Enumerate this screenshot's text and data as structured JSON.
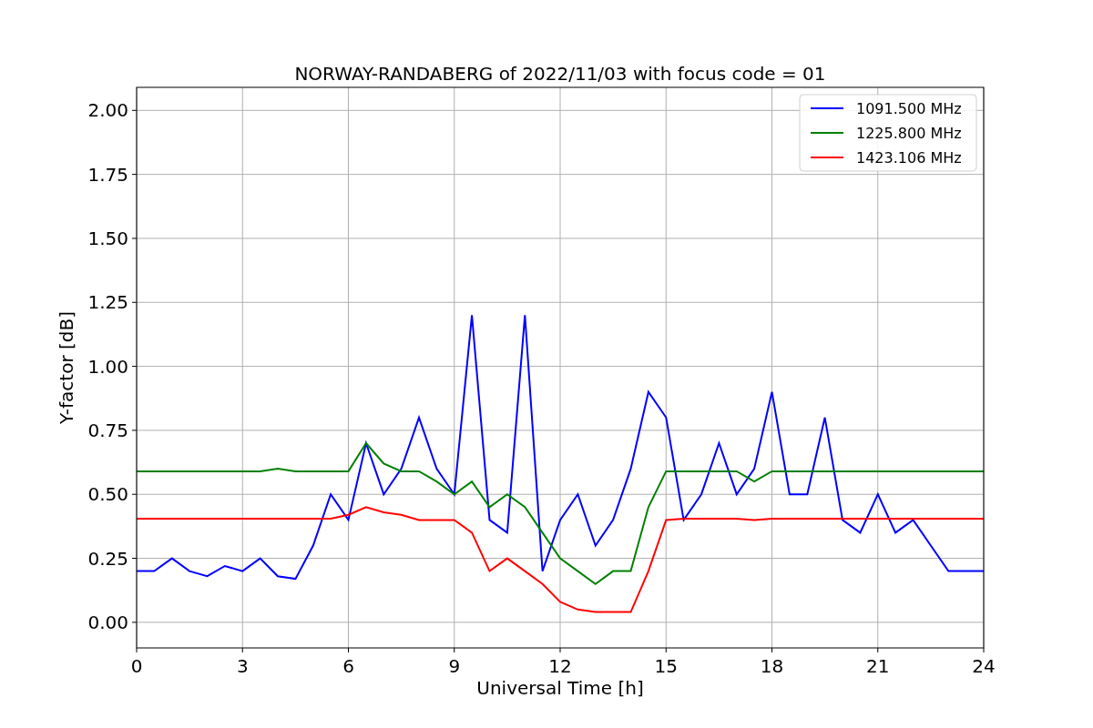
{
  "chart_data": {
    "type": "line",
    "title": "NORWAY-RANDABERG of 2022/11/03 with focus code = 01",
    "xlabel": "Universal Time [h]",
    "ylabel": "Y-factor [dB]",
    "x": [
      0,
      0.5,
      1,
      1.5,
      2,
      2.5,
      3,
      3.5,
      4,
      4.5,
      5,
      5.5,
      6,
      6.5,
      7,
      7.5,
      8,
      8.5,
      9,
      9.5,
      10,
      10.5,
      11,
      11.5,
      12,
      12.5,
      13,
      13.5,
      14,
      14.5,
      15,
      15.5,
      16,
      16.5,
      17,
      17.5,
      18,
      18.5,
      19,
      19.5,
      20,
      20.5,
      21,
      21.5,
      22,
      22.5,
      23,
      23.5,
      24
    ],
    "series": [
      {
        "name": "1091.500 MHz",
        "color": "#0000ff",
        "values": [
          0.2,
          0.2,
          0.25,
          0.2,
          0.18,
          0.22,
          0.2,
          0.25,
          0.18,
          0.17,
          0.3,
          0.5,
          0.4,
          0.7,
          0.5,
          0.6,
          0.8,
          0.6,
          0.5,
          1.2,
          0.4,
          0.35,
          1.2,
          0.2,
          0.4,
          0.5,
          0.3,
          0.4,
          0.6,
          0.9,
          0.8,
          0.4,
          0.5,
          0.7,
          0.5,
          0.6,
          0.9,
          0.5,
          0.5,
          0.8,
          0.4,
          0.35,
          0.5,
          0.35,
          0.4,
          0.3,
          0.2,
          0.2,
          0.2
        ]
      },
      {
        "name": "1225.800 MHz",
        "color": "#008000",
        "values": [
          0.59,
          0.59,
          0.59,
          0.59,
          0.59,
          0.59,
          0.59,
          0.59,
          0.6,
          0.59,
          0.59,
          0.59,
          0.59,
          0.7,
          0.62,
          0.59,
          0.59,
          0.55,
          0.5,
          0.55,
          0.45,
          0.5,
          0.45,
          0.35,
          0.25,
          0.2,
          0.15,
          0.2,
          0.2,
          0.45,
          0.59,
          0.59,
          0.59,
          0.59,
          0.59,
          0.55,
          0.59,
          0.59,
          0.59,
          0.59,
          0.59,
          0.59,
          0.59,
          0.59,
          0.59,
          0.59,
          0.59,
          0.59,
          0.59
        ]
      },
      {
        "name": "1423.106 MHz",
        "color": "#ff0000",
        "values": [
          0.405,
          0.405,
          0.405,
          0.405,
          0.405,
          0.405,
          0.405,
          0.405,
          0.405,
          0.405,
          0.405,
          0.405,
          0.42,
          0.45,
          0.43,
          0.42,
          0.4,
          0.4,
          0.4,
          0.35,
          0.2,
          0.25,
          0.2,
          0.15,
          0.08,
          0.05,
          0.04,
          0.04,
          0.04,
          0.2,
          0.4,
          0.405,
          0.405,
          0.405,
          0.405,
          0.4,
          0.405,
          0.405,
          0.405,
          0.405,
          0.405,
          0.405,
          0.405,
          0.405,
          0.405,
          0.405,
          0.405,
          0.405,
          0.405
        ]
      }
    ],
    "grid": true,
    "legend": true,
    "xlim": [
      0,
      24
    ],
    "ylim": [
      -0.1,
      2.09
    ],
    "xticks": [
      0,
      3,
      6,
      9,
      12,
      15,
      18,
      21,
      24
    ],
    "yticks": [
      {
        "value": 0,
        "label": "0.00"
      },
      {
        "value": 0.25,
        "label": "0.25"
      },
      {
        "value": 0.5,
        "label": "0.50"
      },
      {
        "value": 0.75,
        "label": "0.75"
      },
      {
        "value": 1,
        "label": "1.00"
      },
      {
        "value": 1.25,
        "label": "1.25"
      },
      {
        "value": 1.5,
        "label": "1.50"
      },
      {
        "value": 1.75,
        "label": "1.75"
      },
      {
        "value": 2,
        "label": "2.00"
      }
    ]
  }
}
